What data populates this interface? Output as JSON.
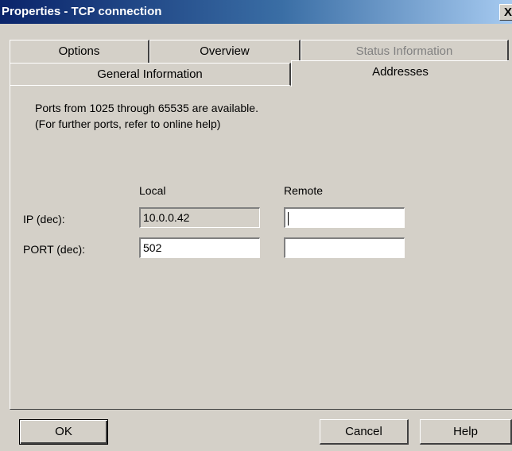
{
  "window": {
    "title": "Properties - TCP connection",
    "close_label": "X"
  },
  "tabs": {
    "options": "Options",
    "overview": "Overview",
    "status": "Status Information",
    "general": "General Information",
    "addresses": "Addresses"
  },
  "info": {
    "line1": "Ports from 1025 through 65535 are available.",
    "line2": "(For further ports, refer to online help)"
  },
  "columns": {
    "local": "Local",
    "remote": "Remote"
  },
  "rows": {
    "ip_label": "IP (dec):",
    "port_label": "PORT (dec):"
  },
  "values": {
    "local_ip": "10.0.0.42",
    "local_port": "502",
    "remote_ip": "",
    "remote_port": ""
  },
  "buttons": {
    "ok": "OK",
    "cancel": "Cancel",
    "help": "Help"
  }
}
